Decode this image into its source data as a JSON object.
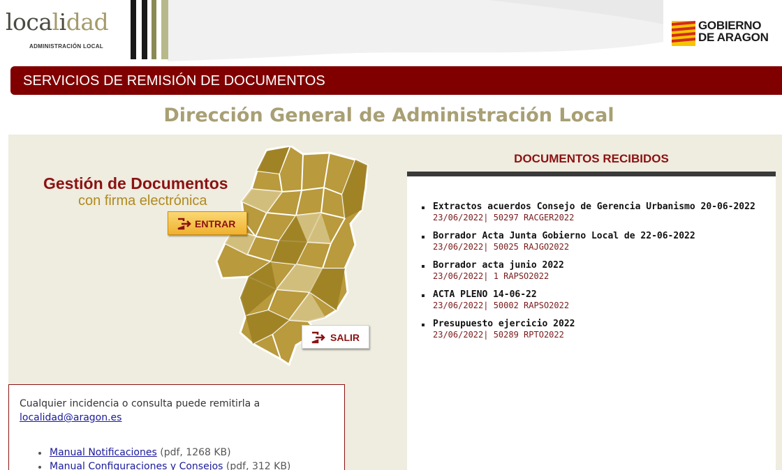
{
  "header": {
    "logo_text_dark_1": "loca",
    "logo_text_light": "l",
    "logo_text_dark_2": "i",
    "logo_text_light_2": "dad",
    "logo_subtitle": "ADMINISTRACIÓN LOCAL",
    "gov_logo_line1": "GOBIERNO",
    "gov_logo_line2": "DE ARAGON"
  },
  "banner": {
    "title": "SERVICIOS DE REMISIÓN DE DOCUMENTOS"
  },
  "page_title": "Dirección General de Administración Local",
  "gestion": {
    "title": "Gestión de Documentos",
    "subtitle": "con firma electrónica",
    "entrar_label": "ENTRAR",
    "salir_label": "SALIR"
  },
  "info": {
    "text": "Cualquier incidencia o consulta puede remitirla a",
    "email": "localidad@aragon.es",
    "manuals": [
      {
        "label": "Manual Notificaciones",
        "meta": "(pdf, 1268 KB)"
      },
      {
        "label": "Manual Configuraciones y Consejos",
        "meta": "(pdf, 312 KB)"
      }
    ]
  },
  "documents": {
    "title": "DOCUMENTOS RECIBIDOS",
    "items": [
      {
        "title": "Extractos acuerdos Consejo de Gerencia Urbanismo 20-06-2022",
        "meta": "23/06/2022| 50297 RACGER2022"
      },
      {
        "title": "Borrador Acta Junta Gobierno Local de 22-06-2022",
        "meta": "23/06/2022| 50025 RAJGO2022"
      },
      {
        "title": "Borrador acta junio 2022",
        "meta": "23/06/2022| 1 RAPSO2022"
      },
      {
        "title": "ACTA PLENO 14-06-22",
        "meta": "23/06/2022| 50002 RAPSO2022"
      },
      {
        "title": "Presupuesto ejercicio 2022",
        "meta": "23/06/2022| 50289 RPTO2022"
      }
    ]
  },
  "colors": {
    "banner": "#800000",
    "accent_red": "#8b1212",
    "title_khaki": "#a89f74",
    "panel_beige": "#efece0",
    "map_gold": "#b99a3c"
  }
}
